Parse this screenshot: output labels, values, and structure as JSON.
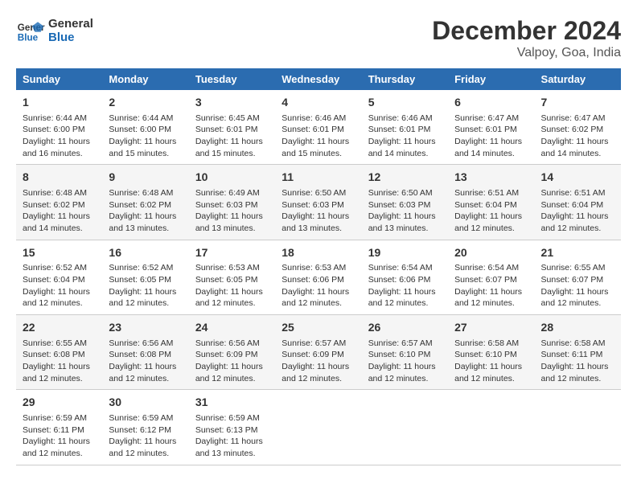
{
  "logo": {
    "line1": "General",
    "line2": "Blue"
  },
  "title": "December 2024",
  "subtitle": "Valpoy, Goa, India",
  "days_of_week": [
    "Sunday",
    "Monday",
    "Tuesday",
    "Wednesday",
    "Thursday",
    "Friday",
    "Saturday"
  ],
  "weeks": [
    [
      {
        "day": "1",
        "info": "Sunrise: 6:44 AM\nSunset: 6:00 PM\nDaylight: 11 hours\nand 16 minutes."
      },
      {
        "day": "2",
        "info": "Sunrise: 6:44 AM\nSunset: 6:00 PM\nDaylight: 11 hours\nand 15 minutes."
      },
      {
        "day": "3",
        "info": "Sunrise: 6:45 AM\nSunset: 6:01 PM\nDaylight: 11 hours\nand 15 minutes."
      },
      {
        "day": "4",
        "info": "Sunrise: 6:46 AM\nSunset: 6:01 PM\nDaylight: 11 hours\nand 15 minutes."
      },
      {
        "day": "5",
        "info": "Sunrise: 6:46 AM\nSunset: 6:01 PM\nDaylight: 11 hours\nand 14 minutes."
      },
      {
        "day": "6",
        "info": "Sunrise: 6:47 AM\nSunset: 6:01 PM\nDaylight: 11 hours\nand 14 minutes."
      },
      {
        "day": "7",
        "info": "Sunrise: 6:47 AM\nSunset: 6:02 PM\nDaylight: 11 hours\nand 14 minutes."
      }
    ],
    [
      {
        "day": "8",
        "info": "Sunrise: 6:48 AM\nSunset: 6:02 PM\nDaylight: 11 hours\nand 14 minutes."
      },
      {
        "day": "9",
        "info": "Sunrise: 6:48 AM\nSunset: 6:02 PM\nDaylight: 11 hours\nand 13 minutes."
      },
      {
        "day": "10",
        "info": "Sunrise: 6:49 AM\nSunset: 6:03 PM\nDaylight: 11 hours\nand 13 minutes."
      },
      {
        "day": "11",
        "info": "Sunrise: 6:50 AM\nSunset: 6:03 PM\nDaylight: 11 hours\nand 13 minutes."
      },
      {
        "day": "12",
        "info": "Sunrise: 6:50 AM\nSunset: 6:03 PM\nDaylight: 11 hours\nand 13 minutes."
      },
      {
        "day": "13",
        "info": "Sunrise: 6:51 AM\nSunset: 6:04 PM\nDaylight: 11 hours\nand 12 minutes."
      },
      {
        "day": "14",
        "info": "Sunrise: 6:51 AM\nSunset: 6:04 PM\nDaylight: 11 hours\nand 12 minutes."
      }
    ],
    [
      {
        "day": "15",
        "info": "Sunrise: 6:52 AM\nSunset: 6:04 PM\nDaylight: 11 hours\nand 12 minutes."
      },
      {
        "day": "16",
        "info": "Sunrise: 6:52 AM\nSunset: 6:05 PM\nDaylight: 11 hours\nand 12 minutes."
      },
      {
        "day": "17",
        "info": "Sunrise: 6:53 AM\nSunset: 6:05 PM\nDaylight: 11 hours\nand 12 minutes."
      },
      {
        "day": "18",
        "info": "Sunrise: 6:53 AM\nSunset: 6:06 PM\nDaylight: 11 hours\nand 12 minutes."
      },
      {
        "day": "19",
        "info": "Sunrise: 6:54 AM\nSunset: 6:06 PM\nDaylight: 11 hours\nand 12 minutes."
      },
      {
        "day": "20",
        "info": "Sunrise: 6:54 AM\nSunset: 6:07 PM\nDaylight: 11 hours\nand 12 minutes."
      },
      {
        "day": "21",
        "info": "Sunrise: 6:55 AM\nSunset: 6:07 PM\nDaylight: 11 hours\nand 12 minutes."
      }
    ],
    [
      {
        "day": "22",
        "info": "Sunrise: 6:55 AM\nSunset: 6:08 PM\nDaylight: 11 hours\nand 12 minutes."
      },
      {
        "day": "23",
        "info": "Sunrise: 6:56 AM\nSunset: 6:08 PM\nDaylight: 11 hours\nand 12 minutes."
      },
      {
        "day": "24",
        "info": "Sunrise: 6:56 AM\nSunset: 6:09 PM\nDaylight: 11 hours\nand 12 minutes."
      },
      {
        "day": "25",
        "info": "Sunrise: 6:57 AM\nSunset: 6:09 PM\nDaylight: 11 hours\nand 12 minutes."
      },
      {
        "day": "26",
        "info": "Sunrise: 6:57 AM\nSunset: 6:10 PM\nDaylight: 11 hours\nand 12 minutes."
      },
      {
        "day": "27",
        "info": "Sunrise: 6:58 AM\nSunset: 6:10 PM\nDaylight: 11 hours\nand 12 minutes."
      },
      {
        "day": "28",
        "info": "Sunrise: 6:58 AM\nSunset: 6:11 PM\nDaylight: 11 hours\nand 12 minutes."
      }
    ],
    [
      {
        "day": "29",
        "info": "Sunrise: 6:59 AM\nSunset: 6:11 PM\nDaylight: 11 hours\nand 12 minutes."
      },
      {
        "day": "30",
        "info": "Sunrise: 6:59 AM\nSunset: 6:12 PM\nDaylight: 11 hours\nand 12 minutes."
      },
      {
        "day": "31",
        "info": "Sunrise: 6:59 AM\nSunset: 6:13 PM\nDaylight: 11 hours\nand 13 minutes."
      },
      null,
      null,
      null,
      null
    ]
  ]
}
